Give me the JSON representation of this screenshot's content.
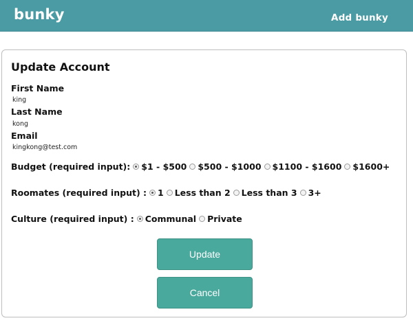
{
  "nav": {
    "brand": "bunky",
    "add_link": "Add bunky"
  },
  "form": {
    "title": "Update Account",
    "first_name": {
      "label": "First Name",
      "value": "king"
    },
    "last_name": {
      "label": "Last Name",
      "value": "kong"
    },
    "email": {
      "label": "Email",
      "value": "kingkong@test.com"
    },
    "budget": {
      "label": "Budget (required input):",
      "options": [
        "$1 - $500",
        "$500 - $1000",
        "$1100 - $1600",
        "$1600+"
      ],
      "selected": "$1 - $500"
    },
    "roommates": {
      "label": "Roomates (required input) :",
      "options": [
        "1",
        "Less than 2",
        "Less than 3",
        "3+"
      ],
      "selected": "1"
    },
    "culture": {
      "label": "Culture (required input) :",
      "options": [
        "Communal",
        "Private"
      ],
      "selected": "Communal"
    },
    "update_button": "Update",
    "cancel_button": "Cancel"
  },
  "colors": {
    "navbar": "#4a9ba3",
    "button": "#4aa99d"
  }
}
